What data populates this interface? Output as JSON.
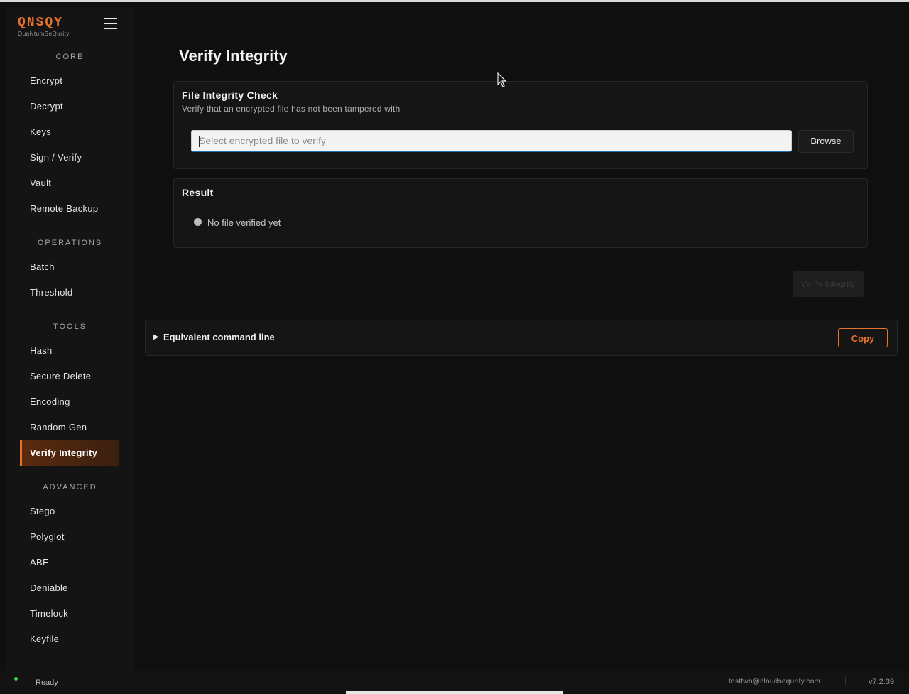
{
  "brand": {
    "logo": "QNSQY",
    "subtitle": "QuaNtumSeQurity"
  },
  "sidebar": {
    "sections": {
      "core": "CORE",
      "operations": "OPERATIONS",
      "tools": "TOOLS",
      "advanced": "ADVANCED"
    },
    "items": [
      {
        "label": "Encrypt"
      },
      {
        "label": "Decrypt"
      },
      {
        "label": "Keys"
      },
      {
        "label": "Sign / Verify"
      },
      {
        "label": "Vault"
      },
      {
        "label": "Remote Backup"
      },
      {
        "label": "Batch"
      },
      {
        "label": "Threshold"
      },
      {
        "label": "Hash"
      },
      {
        "label": "Secure Delete"
      },
      {
        "label": "Encoding"
      },
      {
        "label": "Random Gen"
      },
      {
        "label": "Verify Integrity",
        "active": true
      },
      {
        "label": "Stego"
      },
      {
        "label": "Polyglot"
      },
      {
        "label": "ABE"
      },
      {
        "label": "Deniable"
      },
      {
        "label": "Timelock"
      },
      {
        "label": "Keyfile"
      }
    ]
  },
  "main": {
    "title": "Verify Integrity",
    "check_card": {
      "title": "File Integrity Check",
      "subtitle": "Verify that an encrypted file has not been tampered with",
      "input_placeholder": "Select encrypted file to verify",
      "input_value": "",
      "browse_label": "Browse"
    },
    "result_card": {
      "title": "Result",
      "status_text": "No file verified yet"
    },
    "verify_button": "Verify Integrity",
    "command_line": {
      "label": "Equivalent command line",
      "copy_label": "Copy"
    }
  },
  "statusbar": {
    "state": "Ready",
    "user": "testtwo@cloudsequrity.com",
    "version": "v7.2.39"
  },
  "colors": {
    "accent": "#e8732c",
    "background": "#0f0f0f",
    "panel": "#151515",
    "ready": "#3ccf5a"
  }
}
